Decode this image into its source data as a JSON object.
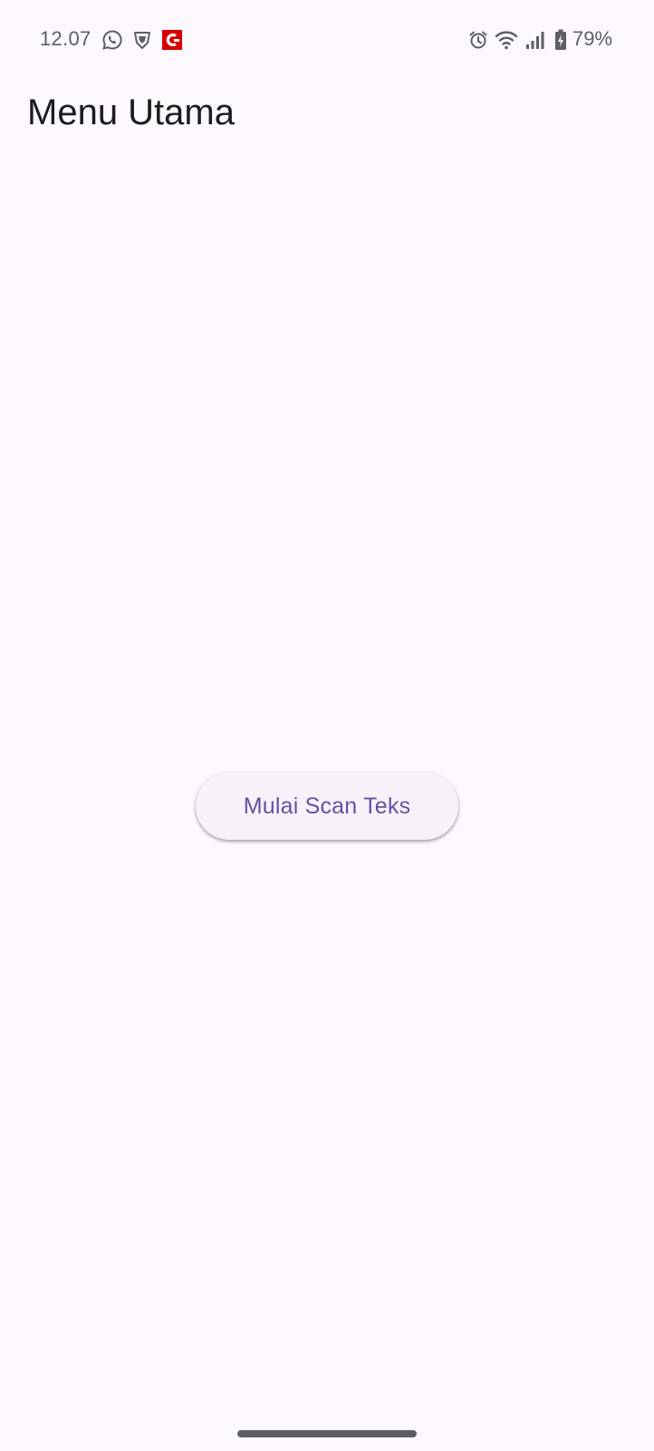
{
  "status_bar": {
    "time": "12.07",
    "battery_percent": "79%",
    "left_icons": [
      "whatsapp-icon",
      "vpn-shield-icon",
      "app-c-icon"
    ],
    "right_icons": [
      "alarm-icon",
      "wifi-icon",
      "signal-icon",
      "battery-charging-icon"
    ]
  },
  "app_bar": {
    "title": "Menu Utama"
  },
  "main": {
    "scan_button_label": "Mulai Scan Teks"
  },
  "colors": {
    "background": "#fdf7fe",
    "button_text": "#6750a4",
    "button_bg": "#f7f2fa",
    "title_text": "#1d1b20",
    "app_icon_red": "#d50000"
  }
}
